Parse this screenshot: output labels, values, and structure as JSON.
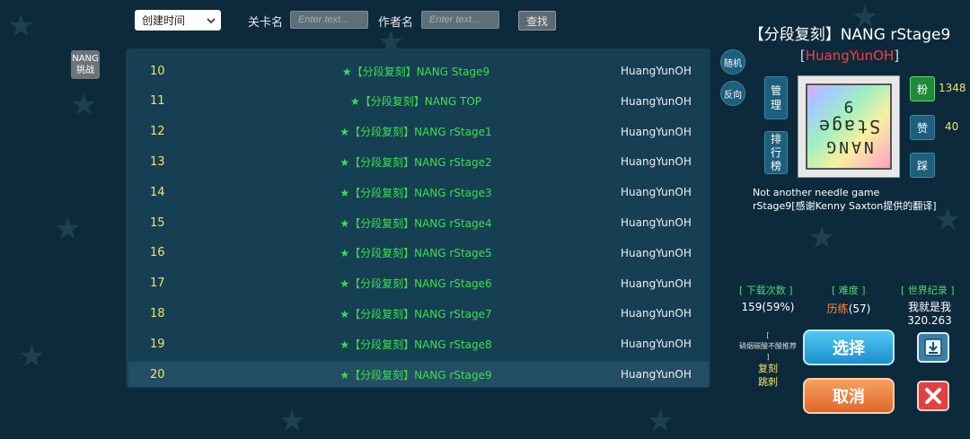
{
  "toolbar": {
    "sort_value": "创建时间",
    "level_name_label": "关卡名",
    "level_name_placeholder": "Enter text...",
    "author_name_label": "作者名",
    "author_name_placeholder": "Enter text...",
    "search_label": "查找"
  },
  "left_button": {
    "line1": "NANG",
    "line2": "挑战"
  },
  "list": [
    {
      "num": "10",
      "title": "★【分段复刻】NANG Stage9",
      "author": "HuangYunOH"
    },
    {
      "num": "11",
      "title": "★【分段复刻】NANG TOP",
      "author": "HuangYunOH"
    },
    {
      "num": "12",
      "title": "★【分段复刻】NANG rStage1",
      "author": "HuangYunOH"
    },
    {
      "num": "13",
      "title": "★【分段复刻】NANG rStage2",
      "author": "HuangYunOH"
    },
    {
      "num": "14",
      "title": "★【分段复刻】NANG rStage3",
      "author": "HuangYunOH"
    },
    {
      "num": "15",
      "title": "★【分段复刻】NANG rStage4",
      "author": "HuangYunOH"
    },
    {
      "num": "16",
      "title": "★【分段复刻】NANG rStage5",
      "author": "HuangYunOH"
    },
    {
      "num": "17",
      "title": "★【分段复刻】NANG rStage6",
      "author": "HuangYunOH"
    },
    {
      "num": "18",
      "title": "★【分段复刻】NANG rStage7",
      "author": "HuangYunOH"
    },
    {
      "num": "19",
      "title": "★【分段复刻】NANG rStage8",
      "author": "HuangYunOH"
    },
    {
      "num": "20",
      "title": "★【分段复刻】NANG rStage9",
      "author": "HuangYunOH"
    }
  ],
  "selected_index": 10,
  "round_buttons": {
    "random": "随机",
    "reverse": "反向"
  },
  "detail": {
    "title": "【分段复刻】NANG rStage9",
    "author_open": "[",
    "author": "HuangYunOH",
    "author_close": "]",
    "manage": "管理",
    "ranking": "排行榜",
    "thumbnail_text": [
      "NANG",
      "Stage",
      "9"
    ],
    "fan_label": "粉",
    "fan_count": "1348",
    "like_label": "赞",
    "like_count": "40",
    "dislike_label": "踩",
    "desc_line1": "Not another needle game",
    "desc_line2": "rStage9[感谢Kenny Saxton提供的翻译]",
    "downloads_header": "[ 下载次数 ]",
    "downloads_value": "159(59%)",
    "difficulty_header": "[ 难度 ]",
    "difficulty_name": "历练",
    "difficulty_num": "(57)",
    "record_header": "[ 世界纪录 ]",
    "record_holder": "我就是我",
    "record_time": "320.263",
    "tiny_open": "[",
    "tiny_text": "硝烟碳酸不酸推荐",
    "tiny_close": "]",
    "tag1": "复刻",
    "tag2": "跳刺",
    "select_label": "选择",
    "cancel_label": "取消"
  },
  "colors": {
    "background": "#0c2a3c",
    "panel": "#163f54",
    "title_green": "#39e04a",
    "number_yellow": "#f4e06a",
    "author_red": "#ff3b3b"
  }
}
